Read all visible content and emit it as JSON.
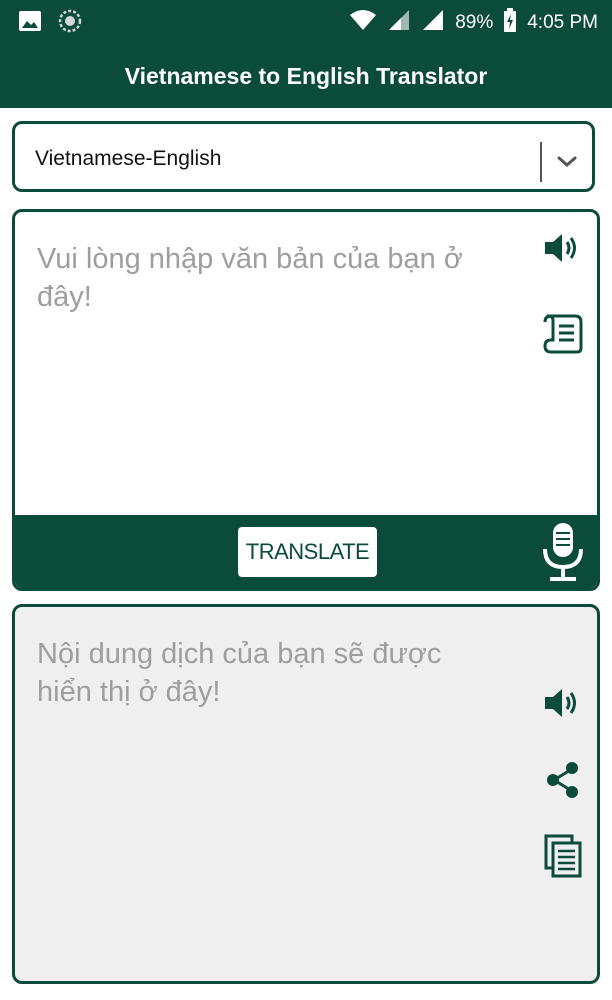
{
  "status_bar": {
    "battery": "89%",
    "time": "4:05 PM",
    "icons": [
      "gallery-icon",
      "aperture-icon",
      "wifi-icon",
      "signal-icon",
      "signal-icon",
      "battery-charging-icon"
    ]
  },
  "app_bar": {
    "title": "Vietnamese to English Translator"
  },
  "language_selector": {
    "selected": "Vietnamese-English"
  },
  "input": {
    "placeholder": "Vui lòng nhập văn bản của bạn ở đây!",
    "icons": [
      "speaker-icon",
      "document-scroll-icon",
      "microphone-icon"
    ]
  },
  "translate_button": {
    "label": "TRANSLATE"
  },
  "output": {
    "placeholder": "Nội dung dịch của bạn sẽ được hiển thị ở đây!",
    "icons": [
      "speaker-icon",
      "share-icon",
      "copy-icon"
    ]
  },
  "colors": {
    "primary": "#0b4b3a",
    "output_background": "#efefef",
    "placeholder_text": "#9e9e9e"
  }
}
